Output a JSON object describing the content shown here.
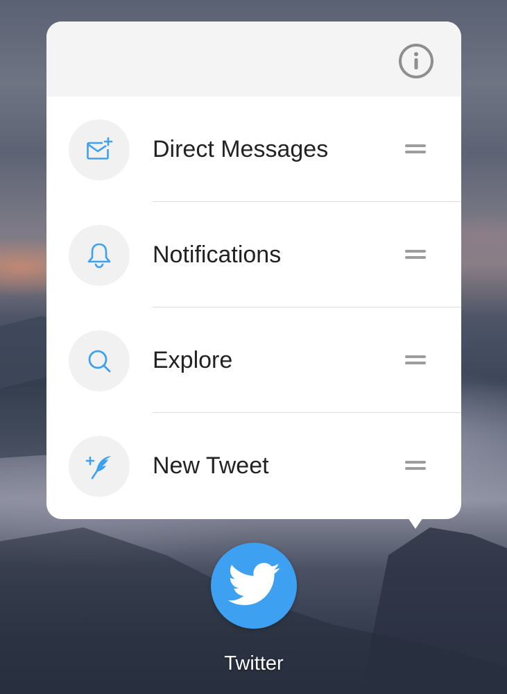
{
  "shortcut_menu": {
    "items": [
      {
        "label": "Direct Messages",
        "icon": "mail-plus-icon"
      },
      {
        "label": "Notifications",
        "icon": "bell-icon"
      },
      {
        "label": "Explore",
        "icon": "search-icon"
      },
      {
        "label": "New Tweet",
        "icon": "feather-plus-icon"
      }
    ],
    "info_icon": "info-icon",
    "drag_icon": "drag-handle-icon"
  },
  "app": {
    "label": "Twitter",
    "icon": "twitter-bird-icon"
  },
  "colors": {
    "accent": "#3da0f0",
    "popup_background": "#ffffff",
    "header_background": "#f4f4f4",
    "text": "#222222"
  }
}
